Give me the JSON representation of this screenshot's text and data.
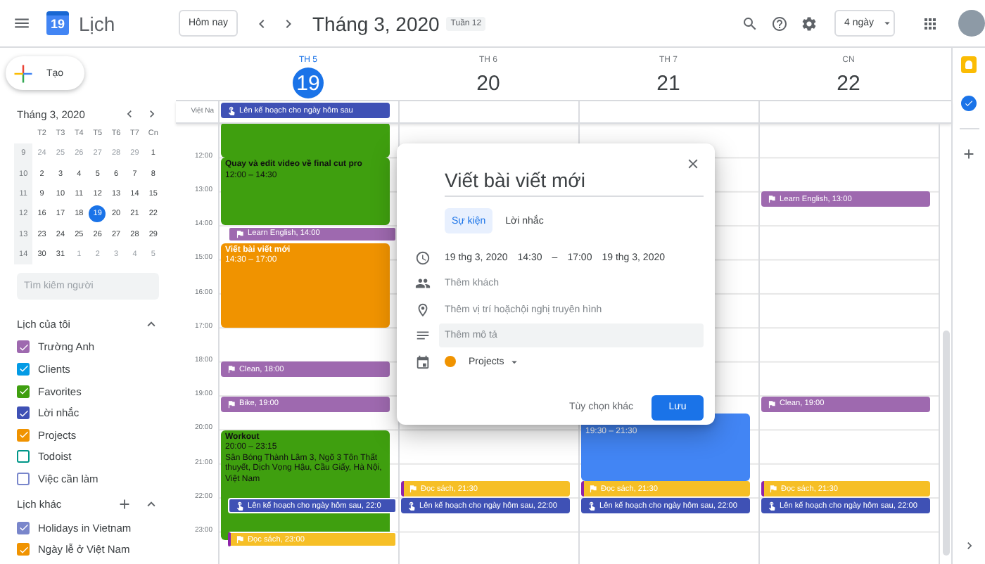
{
  "header": {
    "app_name": "Lịch",
    "logo_day": "19",
    "today_button": "Hôm nay",
    "period": "Tháng 3, 2020",
    "week_badge": "Tuần 12",
    "view_select": "4 ngày"
  },
  "sidebar": {
    "create_button": "Tạo",
    "mini_calendar": {
      "title": "Tháng 3, 2020",
      "weekdays": [
        "T2",
        "T3",
        "T4",
        "T5",
        "T6",
        "T7",
        "Cn"
      ],
      "weeks": [
        {
          "number": "9",
          "days": [
            {
              "label": "24",
              "other_month": true,
              "selected": false
            },
            {
              "label": "25",
              "other_month": true,
              "selected": false
            },
            {
              "label": "26",
              "other_month": true,
              "selected": false
            },
            {
              "label": "27",
              "other_month": true,
              "selected": false
            },
            {
              "label": "28",
              "other_month": true,
              "selected": false
            },
            {
              "label": "29",
              "other_month": true,
              "selected": false
            },
            {
              "label": "1",
              "other_month": false,
              "selected": false
            }
          ]
        },
        {
          "number": "10",
          "days": [
            {
              "label": "2",
              "other_month": false,
              "selected": false
            },
            {
              "label": "3",
              "other_month": false,
              "selected": false
            },
            {
              "label": "4",
              "other_month": false,
              "selected": false
            },
            {
              "label": "5",
              "other_month": false,
              "selected": false
            },
            {
              "label": "6",
              "other_month": false,
              "selected": false
            },
            {
              "label": "7",
              "other_month": false,
              "selected": false
            },
            {
              "label": "8",
              "other_month": false,
              "selected": false
            }
          ]
        },
        {
          "number": "11",
          "days": [
            {
              "label": "9",
              "other_month": false,
              "selected": false
            },
            {
              "label": "10",
              "other_month": false,
              "selected": false
            },
            {
              "label": "11",
              "other_month": false,
              "selected": false
            },
            {
              "label": "12",
              "other_month": false,
              "selected": false
            },
            {
              "label": "13",
              "other_month": false,
              "selected": false
            },
            {
              "label": "14",
              "other_month": false,
              "selected": false
            },
            {
              "label": "15",
              "other_month": false,
              "selected": false
            }
          ]
        },
        {
          "number": "12",
          "days": [
            {
              "label": "16",
              "other_month": false,
              "selected": false
            },
            {
              "label": "17",
              "other_month": false,
              "selected": false
            },
            {
              "label": "18",
              "other_month": false,
              "selected": false
            },
            {
              "label": "19",
              "other_month": false,
              "selected": true
            },
            {
              "label": "20",
              "other_month": false,
              "selected": false
            },
            {
              "label": "21",
              "other_month": false,
              "selected": false
            },
            {
              "label": "22",
              "other_month": false,
              "selected": false
            }
          ]
        },
        {
          "number": "13",
          "days": [
            {
              "label": "23",
              "other_month": false,
              "selected": false
            },
            {
              "label": "24",
              "other_month": false,
              "selected": false
            },
            {
              "label": "25",
              "other_month": false,
              "selected": false
            },
            {
              "label": "26",
              "other_month": false,
              "selected": false
            },
            {
              "label": "27",
              "other_month": false,
              "selected": false
            },
            {
              "label": "28",
              "other_month": false,
              "selected": false
            },
            {
              "label": "29",
              "other_month": false,
              "selected": false
            }
          ]
        },
        {
          "number": "14",
          "days": [
            {
              "label": "30",
              "other_month": false,
              "selected": false
            },
            {
              "label": "31",
              "other_month": false,
              "selected": false
            },
            {
              "label": "1",
              "other_month": true,
              "selected": false
            },
            {
              "label": "2",
              "other_month": true,
              "selected": false
            },
            {
              "label": "3",
              "other_month": true,
              "selected": false
            },
            {
              "label": "4",
              "other_month": true,
              "selected": false
            },
            {
              "label": "5",
              "other_month": true,
              "selected": false
            }
          ]
        }
      ]
    },
    "people_search": {
      "placeholder": "Tìm kiếm người"
    },
    "calendar_groups": [
      {
        "title": "Lịch của tôi",
        "expanded": true,
        "can_add": false,
        "items": [
          {
            "label": "Trường Anh",
            "checked": true,
            "color": "#9e69af"
          },
          {
            "label": "Clients",
            "checked": true,
            "color": "#039be5"
          },
          {
            "label": "Favorites",
            "checked": true,
            "color": "#3f9f0f"
          },
          {
            "label": "Lời nhắc",
            "checked": true,
            "color": "#3f51b5"
          },
          {
            "label": "Projects",
            "checked": true,
            "color": "#f09300"
          },
          {
            "label": "Todoist",
            "checked": false,
            "color": "#009688"
          },
          {
            "label": "Việc cần làm",
            "checked": false,
            "color": "#7986cb"
          }
        ]
      },
      {
        "title": "Lịch khác",
        "expanded": true,
        "can_add": true,
        "items": [
          {
            "label": "Holidays in Vietnam",
            "checked": true,
            "color": "#7986cb"
          },
          {
            "label": "Ngày lễ ở Việt Nam",
            "checked": true,
            "color": "#f09300"
          }
        ]
      }
    ]
  },
  "day_headers": [
    {
      "weekday": "TH 5",
      "day": "19",
      "selected": true
    },
    {
      "weekday": "TH 6",
      "day": "20",
      "selected": false
    },
    {
      "weekday": "TH 7",
      "day": "21",
      "selected": false
    },
    {
      "weekday": "CN",
      "day": "22",
      "selected": false
    }
  ],
  "timezone_label": "Việt Na",
  "time_labels": [
    "12:00",
    "13:00",
    "14:00",
    "15:00",
    "16:00",
    "17:00",
    "18:00",
    "19:00",
    "20:00",
    "21:00",
    "22:00",
    "23:00"
  ],
  "days": [
    {
      "all_day": [
        {
          "kind": "task",
          "title": "Lên kế hoạch cho ngày hôm sau",
          "color": "#3f51b5"
        }
      ],
      "events": [
        {
          "kind": "event",
          "continued": true,
          "color": "#3f9f0f"
        },
        {
          "kind": "event",
          "title": "Quay và edit video về final cut pro",
          "time": "12:00 – 14:30",
          "continued": false,
          "color": "#3f9f0f",
          "dark_text": true
        },
        {
          "kind": "reminder",
          "title": "Learn English, 14:00",
          "color": "#9e69af",
          "indented": true,
          "stripe": false
        },
        {
          "kind": "event",
          "title": "Viết bài viết mới",
          "time": "14:30 – 17:00",
          "continued": false,
          "color": "#f09300",
          "dark_text": false
        },
        {
          "kind": "reminder",
          "title": "Clean, 18:00",
          "color": "#9e69af",
          "indented": false,
          "stripe": false
        },
        {
          "kind": "reminder",
          "title": "Bike, 19:00",
          "color": "#9e69af",
          "indented": false,
          "stripe": false
        },
        {
          "kind": "event",
          "title": "Workout",
          "time": "20:00 – 23:15",
          "location": "Sân Bóng Thành Lâm 3, Ngõ 3 Tôn Thất thuyết, Dịch Vọng Hậu, Cầu Giấy, Hà Nội, Việt Nam",
          "continued": false,
          "color": "#3f9f0f",
          "dark_text": true
        },
        {
          "kind": "task",
          "title": "Lên kế hoạch cho ngày hôm sau, 22:0",
          "color": "#3f51b5",
          "indented": true,
          "stripe": false
        },
        {
          "kind": "reminder",
          "title": "Đọc sách, 23:00",
          "color": "#f6bf26",
          "indented": true,
          "stripe": true
        }
      ]
    },
    {
      "events": [
        {
          "kind": "reminder",
          "title": "Đọc sách, 21:30",
          "color": "#f6bf26",
          "indented": false,
          "stripe": true
        },
        {
          "kind": "task",
          "title": "Lên kế hoạch cho ngày hôm sau, 22:00",
          "color": "#3f51b5",
          "indented": false,
          "stripe": false
        }
      ]
    },
    {
      "events": [
        {
          "kind": "event",
          "time": "19:30 – 21:30",
          "continued": false,
          "color": "#4285f4",
          "dark_text": false
        },
        {
          "kind": "reminder",
          "title": "Đọc sách, 21:30",
          "color": "#f6bf26",
          "indented": false,
          "stripe": true
        },
        {
          "kind": "task",
          "title": "Lên kế hoạch cho ngày hôm sau, 22:00",
          "color": "#3f51b5",
          "indented": false,
          "stripe": false
        }
      ]
    },
    {
      "events": [
        {
          "kind": "reminder",
          "title": "Learn English, 13:00",
          "color": "#9e69af",
          "indented": false,
          "stripe": false
        },
        {
          "kind": "reminder",
          "title": "Clean, 19:00",
          "color": "#9e69af",
          "indented": false,
          "stripe": false
        },
        {
          "kind": "reminder",
          "title": "Đọc sách, 21:30",
          "color": "#f6bf26",
          "indented": false,
          "stripe": true
        },
        {
          "kind": "task",
          "title": "Lên kế hoạch cho ngày hôm sau, 22:00",
          "color": "#3f51b5",
          "indented": false,
          "stripe": false
        }
      ]
    }
  ],
  "dialog": {
    "title_value": "Viết bài viết mới",
    "tabs": [
      {
        "label": "Sự kiện",
        "selected": true
      },
      {
        "label": "Lời nhắc",
        "selected": false
      }
    ],
    "start_date": "19 thg 3, 2020",
    "start_time": "14:30",
    "dash": "–",
    "end_time": "17:00",
    "end_date": "19 thg 3, 2020",
    "guests": {
      "placeholder": "Thêm khách"
    },
    "location": {
      "placeholder": "Thêm vị trí hoặchội nghị truyền hình"
    },
    "description": {
      "placeholder": "Thêm mô tả"
    },
    "calendar": {
      "label": "Projects",
      "color": "#f09300"
    },
    "more_options_button": "Tùy chọn khác",
    "save_button": "Lưu"
  }
}
